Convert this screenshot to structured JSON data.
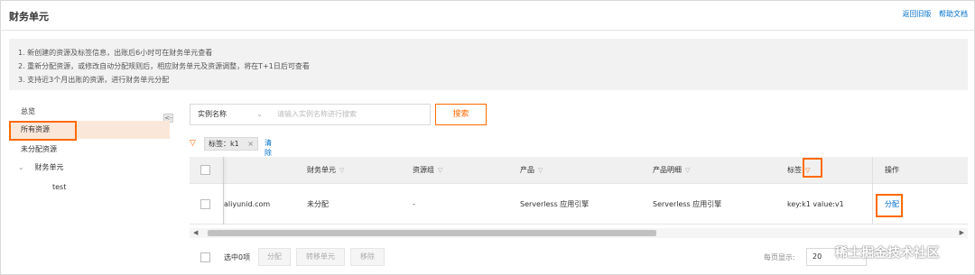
{
  "header": {
    "title": "财务单元",
    "links": [
      "返回旧版",
      "帮助文档"
    ]
  },
  "notice": {
    "lines": [
      "1. 新创建的资源及标签信息，出账后6小时可在财务单元查看",
      "2. 重新分配资源，或修改自动分配规则后，相应财务单元及资源调整，将在T+1日后可查看",
      "3. 支持近3个月出账的资源，进行财务单元分配"
    ]
  },
  "sidebar": {
    "collapse_icon": "<-",
    "items": [
      {
        "label": "总览"
      },
      {
        "label": "所有资源"
      },
      {
        "label": "未分配资源"
      },
      {
        "label": "财务单元",
        "expand_icon": "chevron-down-icon"
      },
      {
        "label": "test"
      }
    ]
  },
  "search": {
    "field_value": "实例名称",
    "placeholder": "请输入实例名称进行搜索",
    "button": "搜索"
  },
  "filter": {
    "tag_label": "标签：k1",
    "clear": "清除"
  },
  "table": {
    "headers": [
      "财务单元",
      "资源组",
      "产品",
      "产品明细",
      "标签",
      "操作"
    ],
    "rows": [
      {
        "id": "aliyunid.com",
        "finance_unit": "未分配",
        "resource_group": "-",
        "product": "Serverless 应用引擎",
        "product_detail": "Serverless 应用引擎",
        "tag": "key:k1 value:v1",
        "action": "分配"
      }
    ]
  },
  "footer": {
    "selected": "选中0项",
    "buttons": [
      "分配",
      "转移单元",
      "移除"
    ],
    "per_page_label": "每页显示:",
    "per_page_value": "20"
  },
  "watermark": "稀土掘金技术社区",
  "colors": {
    "accent": "#ff6a00",
    "link": "#0070cc",
    "active_bg": "#fbe7d9"
  }
}
